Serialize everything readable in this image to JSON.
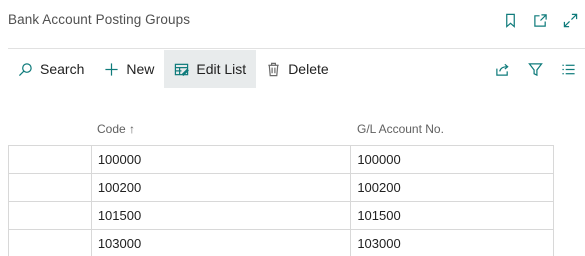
{
  "page": {
    "title": "Bank Account Posting Groups"
  },
  "header_actions": {
    "bookmark_icon": "bookmark-icon",
    "open_new_window_icon": "open-in-new-window-icon",
    "expand_icon": "expand-icon"
  },
  "toolbar": {
    "search_label": "Search",
    "new_label": "New",
    "edit_list_label": "Edit List",
    "delete_label": "Delete"
  },
  "table": {
    "columns": {
      "code": "Code",
      "code_sort": "↑",
      "gl_account": "G/L Account No."
    },
    "rows": [
      {
        "code": "100000",
        "gl_account": "100000"
      },
      {
        "code": "100200",
        "gl_account": "100200"
      },
      {
        "code": "101500",
        "gl_account": "101500"
      },
      {
        "code": "103000",
        "gl_account": "103000"
      }
    ]
  },
  "colors": {
    "accent": "#0f7b7b",
    "active_button_bg": "#e8ebec",
    "border": "#d8d8d8"
  }
}
